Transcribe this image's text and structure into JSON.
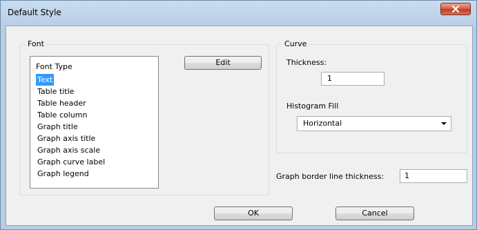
{
  "window": {
    "title": "Default Style"
  },
  "font_group": {
    "label": "Font",
    "list_header": "Font Type",
    "items": [
      "Text",
      "Table title",
      "Table header",
      "Table column",
      "Graph title",
      "Graph axis title",
      "Graph axis scale",
      "Graph curve label",
      "Graph legend"
    ],
    "selected": "Text",
    "edit_label": "Edit"
  },
  "curve_group": {
    "label": "Curve",
    "thickness_label": "Thickness:",
    "thickness_value": "1",
    "histogram_label": "Histogram Fill",
    "histogram_value": "Horizontal"
  },
  "graph_border": {
    "label": "Graph border line thickness:",
    "value": "1"
  },
  "buttons": {
    "ok": "OK",
    "cancel": "Cancel"
  },
  "icons": {
    "close": "close-icon",
    "dropdown": "chevron-down-icon"
  },
  "colors": {
    "selection": "#3399ff",
    "close_button": "#c23a20"
  }
}
